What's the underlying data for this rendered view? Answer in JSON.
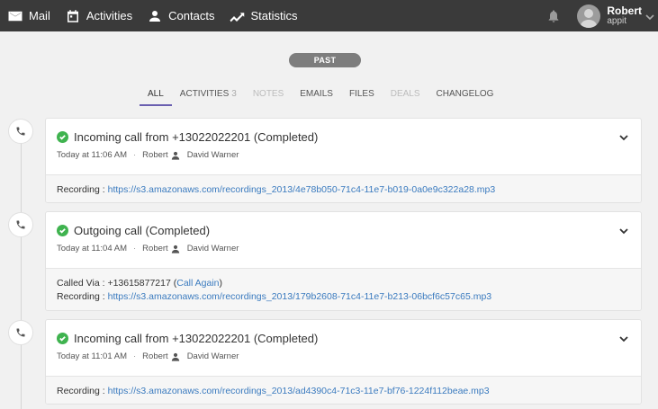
{
  "nav": {
    "items": [
      {
        "icon": "mail-icon",
        "label": "Mail"
      },
      {
        "icon": "calendar-icon",
        "label": "Activities"
      },
      {
        "icon": "person-icon",
        "label": "Contacts"
      },
      {
        "icon": "trend-icon",
        "label": "Statistics"
      }
    ],
    "user": {
      "name": "Robert",
      "sub": "appit"
    }
  },
  "past_label": "PAST",
  "tabs": [
    {
      "label": "ALL",
      "state": "active"
    },
    {
      "label": "ACTIVITIES",
      "count": "3",
      "state": "normal"
    },
    {
      "label": "NOTES",
      "state": "disabled"
    },
    {
      "label": "EMAILS",
      "state": "normal"
    },
    {
      "label": "FILES",
      "state": "normal"
    },
    {
      "label": "DEALS",
      "state": "disabled"
    },
    {
      "label": "CHANGELOG",
      "state": "normal"
    }
  ],
  "cards": [
    {
      "title": "Incoming call from +13022022201 (Completed)",
      "time": "Today at 11:06 AM",
      "owner": "Robert",
      "contact": "David Warner",
      "called_via_label": "",
      "called_via": "",
      "call_again": "",
      "recording_label": "Recording :",
      "recording_url": "https://s3.amazonaws.com/recordings_2013/4e78b050-71c4-11e7-b019-0a0e9c322a28.mp3"
    },
    {
      "title": "Outgoing call (Completed)",
      "time": "Today at 11:04 AM",
      "owner": "Robert",
      "contact": "David Warner",
      "called_via_label": "Called Via :",
      "called_via": "+13615877217",
      "call_again": "Call Again",
      "recording_label": "Recording :",
      "recording_url": "https://s3.amazonaws.com/recordings_2013/179b2608-71c4-11e7-b213-06bcf6c57c65.mp3"
    },
    {
      "title": "Incoming call from +13022022201 (Completed)",
      "time": "Today at 11:01 AM",
      "owner": "Robert",
      "contact": "David Warner",
      "called_via_label": "",
      "called_via": "",
      "call_again": "",
      "recording_label": "Recording :",
      "recording_url": "https://s3.amazonaws.com/recordings_2013/ad4390c4-71c3-11e7-bf76-1224f112beae.mp3"
    }
  ],
  "colors": {
    "topbar": "#3a3a3a",
    "accent": "#6a5fb0",
    "success": "#3fb34f",
    "link": "#3b7bbf"
  }
}
